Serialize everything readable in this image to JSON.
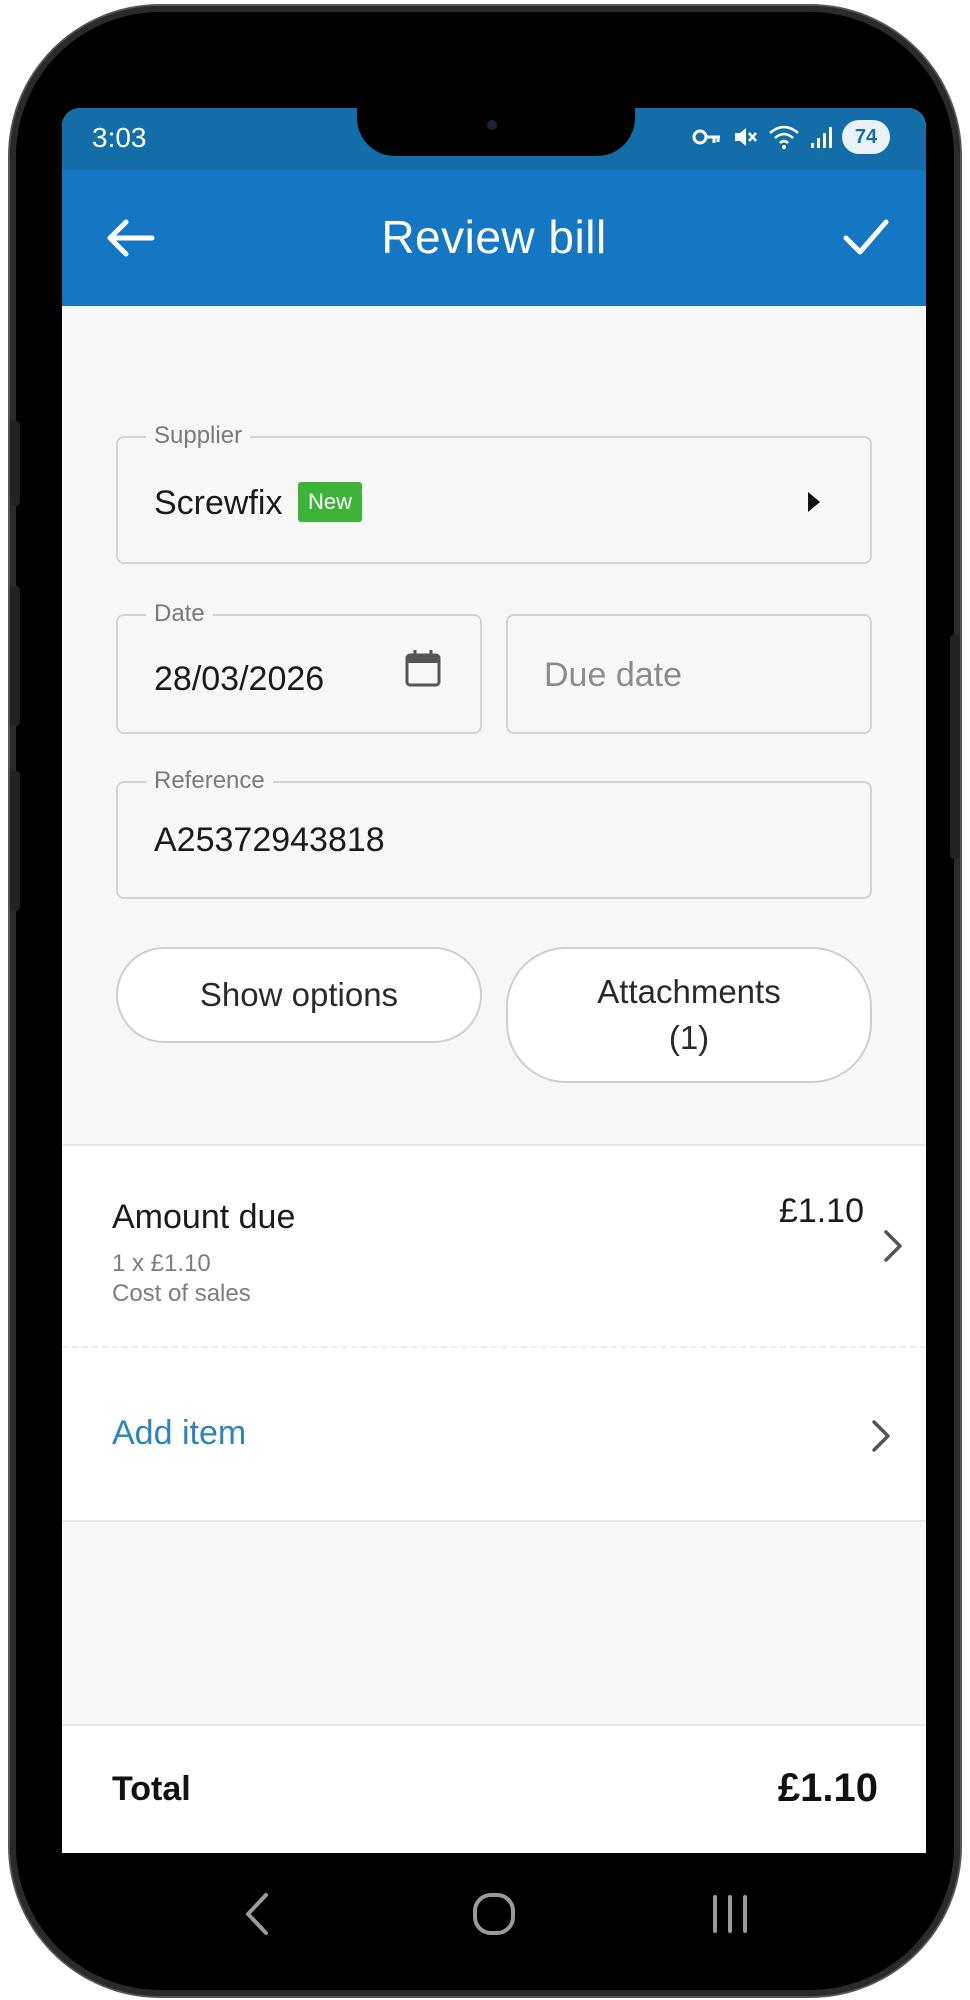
{
  "status_bar": {
    "time": "3:03",
    "battery": "74",
    "icons": [
      "key-icon",
      "mute-icon",
      "wifi-icon",
      "signal-icon"
    ]
  },
  "app_bar": {
    "title": "Review bill",
    "back_icon": "arrow-left-icon",
    "confirm_icon": "check-icon",
    "color": "#1577c3"
  },
  "form": {
    "supplier": {
      "label": "Supplier",
      "value": "Screwfix",
      "badge": "New",
      "badge_color": "#3db33a"
    },
    "date": {
      "label": "Date",
      "value": "28/03/2026"
    },
    "due_date": {
      "placeholder": "Due date"
    },
    "reference": {
      "label": "Reference",
      "value": "A25372943818"
    },
    "show_options_label": "Show options",
    "attachments_label": "Attachments",
    "attachments_count": "(1)"
  },
  "items": [
    {
      "title": "Amount due",
      "quantity_line": "1 x £1.10",
      "category": "Cost of sales",
      "amount": "£1.10"
    }
  ],
  "add_item_label": "Add item",
  "total": {
    "label": "Total",
    "value": "£1.10"
  },
  "nav_bar": {
    "icons": [
      "back-nav-icon",
      "home-nav-icon",
      "recents-nav-icon"
    ]
  }
}
